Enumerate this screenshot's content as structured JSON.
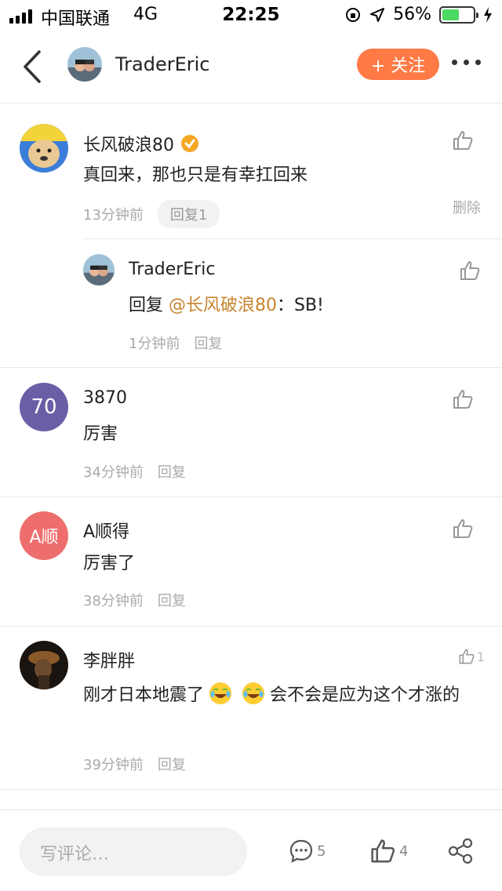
{
  "status_bar": {
    "carrier": "中国联通",
    "network": "4G",
    "time": "22:25",
    "battery": "56%",
    "battery_level": 0.56
  },
  "nav": {
    "back_icon": "chevron-left-icon",
    "title": "TraderEric",
    "follow_label": "+ 关注",
    "more_icon": "more-icon"
  },
  "comments": [
    {
      "name": "长风破浪80",
      "text": "真回来，那也只是有幸扛回来",
      "time": "13分钟前",
      "reply_label": "回复1",
      "delete_label": "删除",
      "reply": {
        "name": "TraderEric",
        "prefix": "回复 ",
        "mention": "@长风破浪80",
        "suffix": "：SB!",
        "time": "1分钟前",
        "reply_label": "回复"
      }
    },
    {
      "name": "3870",
      "avatar_text": "70",
      "avatar_color": "#6a5fa6",
      "text": "厉害",
      "time": "34分钟前",
      "reply_label": "回复"
    },
    {
      "name": "A顺得",
      "avatar_text": "A顺",
      "avatar_color": "#ee6e6e",
      "text": "厉害了",
      "time": "38分钟前",
      "reply_label": "回复"
    },
    {
      "name": "李胖胖",
      "text_a": "刚才日本地震了",
      "text_b": "会不会是应为这个才涨的",
      "time": "39分钟前",
      "reply_label": "回复",
      "likes": "1"
    }
  ],
  "bottom": {
    "placeholder": "写评论…",
    "comment_count": "5",
    "like_count": "4",
    "share_icon": "share-icon"
  },
  "colors": {
    "accent": "#ff7a45",
    "mention": "#c8842d",
    "verified": "#f5a623"
  }
}
